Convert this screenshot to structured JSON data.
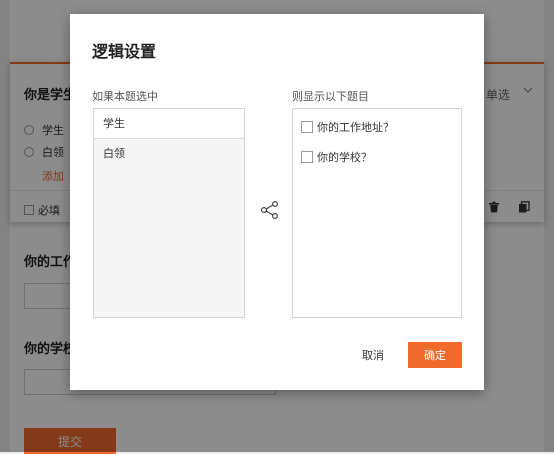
{
  "colors": {
    "accent": "#f06a2c",
    "overlay": "rgba(0,0,0,0.45)"
  },
  "background_form": {
    "active_question": {
      "title": "你是学生",
      "type_label": "单选",
      "options": [
        "学生",
        "白领"
      ],
      "add_option_label": "添加",
      "required_label": "必填",
      "icons": [
        "chevron-down-icon",
        "trash-icon",
        "copy-icon"
      ]
    },
    "questions": [
      {
        "title": "你的工作"
      },
      {
        "title": "你的学校"
      }
    ],
    "submit_label": "提交"
  },
  "dialog": {
    "title": "逻辑设置",
    "left_label": "如果本题选中",
    "right_label": "则显示以下题目",
    "left_options": [
      "学生",
      "白领"
    ],
    "selected_index": 0,
    "right_questions": [
      "你的工作地址？",
      "你的学校？"
    ],
    "link_icon": "link-flow-icon",
    "cancel_label": "取消",
    "ok_label": "确定"
  }
}
